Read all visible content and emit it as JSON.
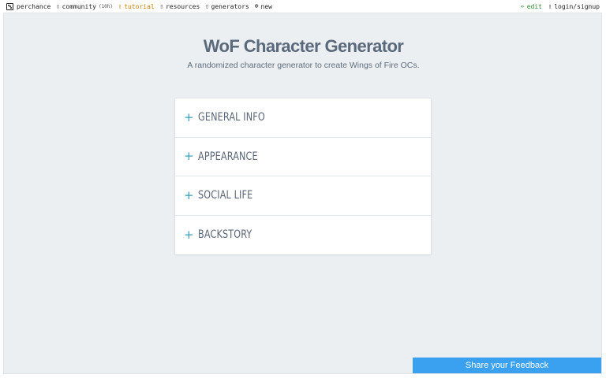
{
  "topbar": {
    "brand": "perchance",
    "community": "community",
    "community_count": "(10h)",
    "tutorial": "tutorial",
    "resources": "resources",
    "generators": "generators",
    "new": "new",
    "edit": "edit",
    "login": "login/signup",
    "icons": {
      "brand": "dice-icon",
      "community": "chat-icon",
      "tutorial": "book-icon",
      "resources": "folder-icon",
      "generators": "list-icon",
      "new": "plus-circle-icon",
      "edit": "pencil-icon",
      "login": "user-icon"
    }
  },
  "page": {
    "title": "WoF Character Generator",
    "subtitle": "A randomized character generator to create Wings of Fire OCs."
  },
  "sections": [
    {
      "label": "GENERAL INFO",
      "expanded": false
    },
    {
      "label": "APPEARANCE",
      "expanded": false
    },
    {
      "label": "SOCIAL LIFE",
      "expanded": false
    },
    {
      "label": "BACKSTORY",
      "expanded": false
    }
  ],
  "feedback": {
    "label": "Share your Feedback"
  },
  "colors": {
    "title": "#5a6a7c",
    "accent": "#3aa0b8",
    "feedback_bg": "#3aa0f0",
    "tutorial": "#cc7a00",
    "edit": "#2e8b2e",
    "panel_bg": "#eceff2"
  }
}
